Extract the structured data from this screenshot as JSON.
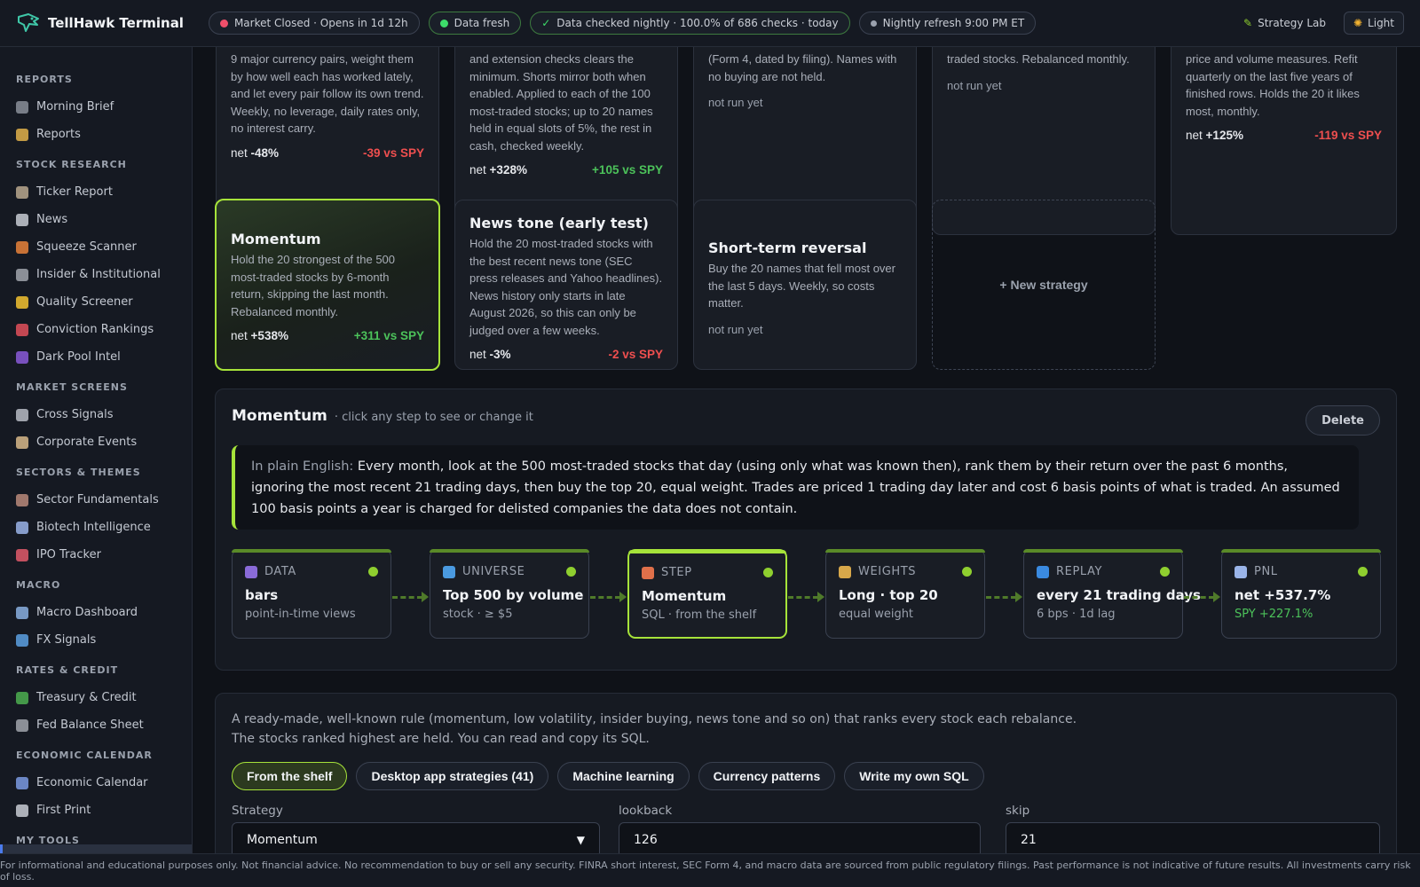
{
  "app": {
    "title": "TellHawk Terminal"
  },
  "topbar": {
    "market_status": "Market Closed · Opens in 1d 12h",
    "data_status": "Data fresh",
    "checks": "Data checked nightly · 100.0% of 686 checks · today",
    "refresh": "Nightly refresh 9:00 PM ET",
    "strategy_lab": "Strategy Lab",
    "theme": "Light",
    "colors": {
      "closed_dot": "#ef4f6a",
      "fresh_dot": "#3ddc6a",
      "refresh_dot": "#9aa1ad"
    }
  },
  "sidebar": {
    "sections": [
      {
        "title": "REPORTS",
        "items": [
          {
            "label": "Morning Brief",
            "icon": "newspaper-icon",
            "color": "#8a8f99"
          },
          {
            "label": "Reports",
            "icon": "folder-icon",
            "color": "#e0b14a"
          }
        ]
      },
      {
        "title": "STOCK RESEARCH",
        "items": [
          {
            "label": "Ticker Report",
            "icon": "notepad-icon",
            "color": "#b9a88e"
          },
          {
            "label": "News",
            "icon": "pen-icon",
            "color": "#c7cbd2"
          },
          {
            "label": "Squeeze Scanner",
            "icon": "lightning-icon",
            "color": "#e8823a"
          },
          {
            "label": "Insider & Institutional",
            "icon": "bank-icon",
            "color": "#a0a4ab"
          },
          {
            "label": "Quality Screener",
            "icon": "star-icon",
            "color": "#f2c230"
          },
          {
            "label": "Conviction Rankings",
            "icon": "target-icon",
            "color": "#e2505a"
          },
          {
            "label": "Dark Pool Intel",
            "icon": "orb-icon",
            "color": "#8a5bd8"
          }
        ]
      },
      {
        "title": "MARKET SCREENS",
        "items": [
          {
            "label": "Cross Signals",
            "icon": "link-icon",
            "color": "#b7bcc4"
          },
          {
            "label": "Corporate Events",
            "icon": "clipboard-icon",
            "color": "#d7b98a"
          }
        ]
      },
      {
        "title": "SECTORS & THEMES",
        "items": [
          {
            "label": "Sector Fundamentals",
            "icon": "factory-icon",
            "color": "#b98a7a"
          },
          {
            "label": "Biotech Intelligence",
            "icon": "syringe-icon",
            "color": "#9ab4e8"
          },
          {
            "label": "IPO Tracker",
            "icon": "rocket-icon",
            "color": "#e05a6a"
          }
        ]
      },
      {
        "title": "MACRO",
        "items": [
          {
            "label": "Macro Dashboard",
            "icon": "bar-chart-icon",
            "color": "#8ab0e0"
          },
          {
            "label": "FX Signals",
            "icon": "exchange-icon",
            "color": "#5aa0e0"
          }
        ]
      },
      {
        "title": "RATES & CREDIT",
        "items": [
          {
            "label": "Treasury & Credit",
            "icon": "cash-icon",
            "color": "#4caf50"
          },
          {
            "label": "Fed Balance Sheet",
            "icon": "bank-icon",
            "color": "#a0a4ab"
          }
        ]
      },
      {
        "title": "ECONOMIC CALENDAR",
        "items": [
          {
            "label": "Economic Calendar",
            "icon": "calendar-icon",
            "color": "#7a9ae0"
          },
          {
            "label": "First Print",
            "icon": "ruler-icon",
            "color": "#c7cbd2"
          }
        ]
      },
      {
        "title": "MY TOOLS",
        "items": []
      }
    ]
  },
  "cards_row1": [
    {
      "desc": "9 major currency pairs, weight them by how well each has worked lately, and let every pair follow its own trend. Weekly, no leverage, daily rates only, no interest carry.",
      "net_label": "net",
      "net": "-48%",
      "vs": "-39 vs SPY",
      "vs_positive": false
    },
    {
      "desc": "and extension checks clears the minimum. Shorts mirror both when enabled. Applied to each of the 100 most-traded stocks; up to 20 names held in equal slots of 5%, the rest in cash, checked weekly.",
      "net_label": "net",
      "net": "+328%",
      "vs": "+105 vs SPY",
      "vs_positive": true
    },
    {
      "desc": "(Form 4, dated by filing). Names with no buying are not held.",
      "status": "not run yet"
    },
    {
      "desc": "traded stocks. Rebalanced monthly.",
      "status": "not run yet"
    },
    {
      "desc": "price and volume measures. Refit quarterly on the last five years of finished rows. Holds the 20 it likes most, monthly.",
      "net_label": "net",
      "net": "+125%",
      "vs": "-119 vs SPY",
      "vs_positive": false
    }
  ],
  "cards_row2": [
    {
      "title": "Momentum",
      "desc": "Hold the 20 strongest of the 500 most-traded stocks by 6-month return, skipping the last month. Rebalanced monthly.",
      "net_label": "net",
      "net": "+538%",
      "vs": "+311 vs SPY",
      "vs_positive": true
    },
    {
      "title": "News tone (early test)",
      "desc": "Hold the 20 most-traded stocks with the best recent news tone (SEC press releases and Yahoo headlines). News history only starts in late August 2026, so this can only be judged over a few weeks.",
      "net_label": "net",
      "net": "-3%",
      "vs": "-2 vs SPY",
      "vs_positive": false
    },
    {
      "title": "Short-term reversal",
      "desc": "Buy the 20 names that fell most over the last 5 days. Weekly, so costs matter.",
      "status": "not run yet"
    }
  ],
  "new_strategy": "+  New strategy",
  "detail": {
    "title": "Momentum",
    "subtitle": "· click any step to see or change it",
    "delete": "Delete",
    "plain_lead": "In plain English:",
    "plain_text": "Every month, look at the 500 most-traded stocks that day (using only what was known then), rank them by their return over the past 6 months, ignoring the most recent 21 trading days, then buy the top 20, equal weight. Trades are priced 1 trading day later and cost 6 basis points of what is traded. An assumed 100 basis points a year is charged for delisted companies the data does not contain.",
    "steps": [
      {
        "label": "DATA",
        "icon": "database-icon",
        "icon_color": "#8a6bd8",
        "value": "bars",
        "meta": "point-in-time views"
      },
      {
        "label": "UNIVERSE",
        "icon": "globe-icon",
        "icon_color": "#4a9ae0",
        "value": "Top 500 by volume",
        "meta": "stock · ≥ $5"
      },
      {
        "label": "STEP",
        "icon": "abacus-icon",
        "icon_color": "#e0704a",
        "value": "Momentum",
        "meta": "SQL · from the shelf"
      },
      {
        "label": "WEIGHTS",
        "icon": "scales-icon",
        "icon_color": "#d8a84a",
        "value": "Long · top 20",
        "meta": "equal weight"
      },
      {
        "label": "REPLAY",
        "icon": "rewind-icon",
        "icon_color": "#3a8ae0",
        "value": "every 21 trading days",
        "meta": "6 bps · 1d lag"
      },
      {
        "label": "PNL",
        "icon": "chart-up-icon",
        "icon_color": "#9ab4e8",
        "value": "net +537.7%",
        "meta": "SPY +227.1%"
      }
    ]
  },
  "shelf": {
    "desc": "A ready-made, well-known rule (momentum, low volatility, insider buying, news tone and so on) that ranks every stock each rebalance. The stocks ranked highest are held. You can read and copy its SQL.",
    "tabs": [
      "From the shelf",
      "Desktop app strategies (41)",
      "Machine learning",
      "Currency patterns",
      "Write my own SQL"
    ],
    "fields": {
      "strategy_label": "Strategy",
      "strategy_value": "Momentum",
      "lookback_label": "lookback",
      "lookback_value": "126",
      "skip_label": "skip",
      "skip_value": "21"
    }
  },
  "footer": "For informational and educational purposes only. Not financial advice. No recommendation to buy or sell any security. FINRA short interest, SEC Form 4, and macro data are sourced from public regulatory filings. Past performance is not indicative of future results. All investments carry risk of loss."
}
